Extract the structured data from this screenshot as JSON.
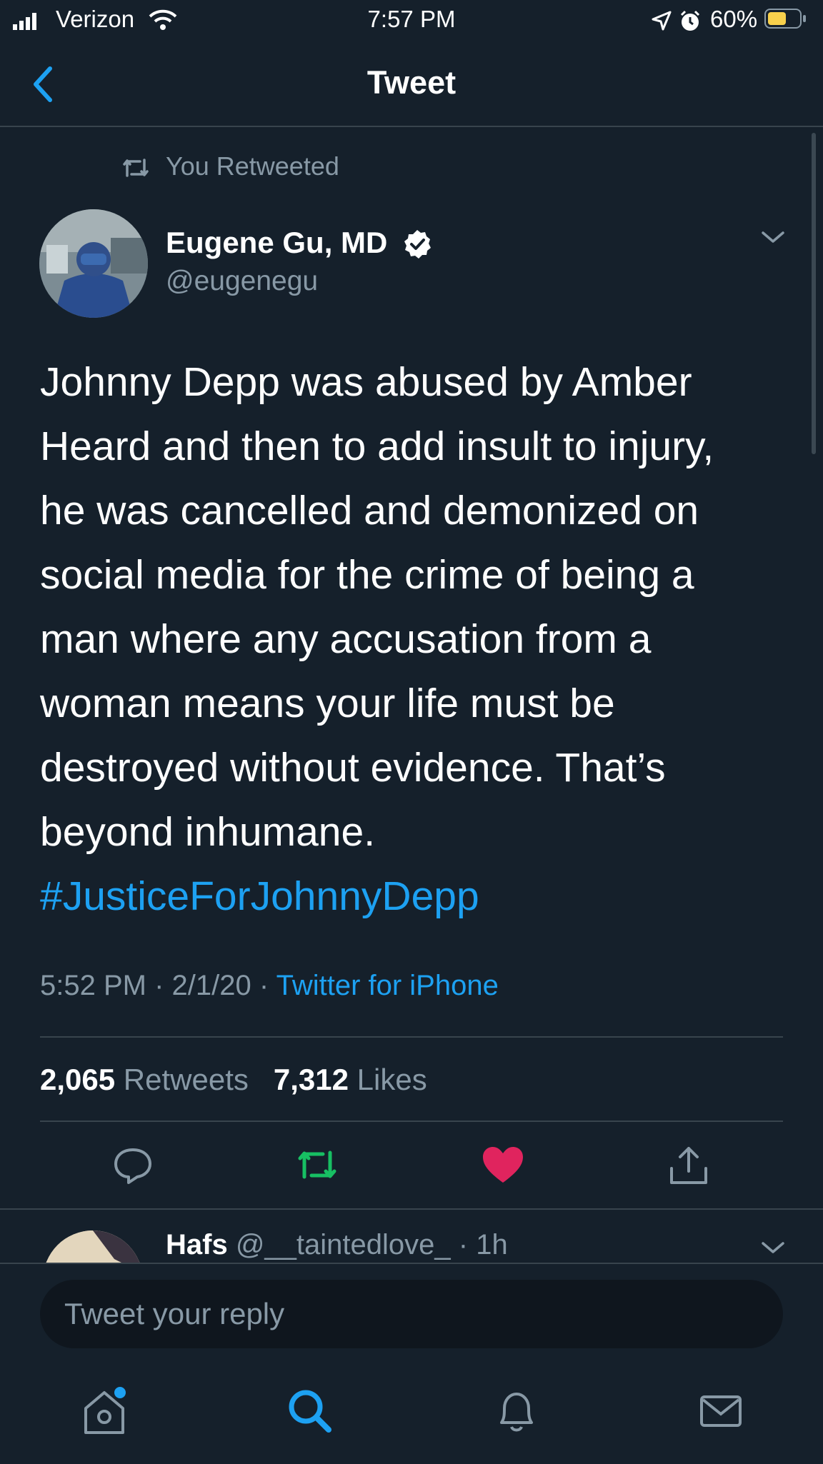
{
  "status_bar": {
    "carrier": "Verizon",
    "time": "7:57 PM",
    "battery_percent": "60%",
    "battery_level": 0.6,
    "battery_color": "#f7d04c"
  },
  "nav": {
    "title": "Tweet",
    "back_icon": "chevron-left-icon"
  },
  "tweet": {
    "retweet_context": "You Retweeted",
    "author": {
      "name": "Eugene Gu, MD",
      "handle": "@eugenegu",
      "verified": true
    },
    "lines": [
      "Johnny Depp was abused by Amber",
      "Heard and then to add insult to injury,",
      "he was cancelled and demonized on",
      "social media for the crime of being a",
      "man where any accusation from a",
      "woman means your life must be",
      "destroyed without evidence. That’s",
      "beyond inhumane."
    ],
    "hashtag": "#JusticeForJohnnyDepp",
    "time": "5:52 PM",
    "date": "2/1/20",
    "source": "Twitter for iPhone",
    "retweets_count": "2,065",
    "retweets_label": "Retweets",
    "likes_count": "7,312",
    "likes_label": "Likes",
    "retweeted": true,
    "liked": true
  },
  "reply_preview": {
    "name": "Hafs",
    "handle_time": "@__taintedlove_ · 1h"
  },
  "compose": {
    "placeholder": "Tweet your reply"
  },
  "tab_bar": [
    "home-icon",
    "search-icon",
    "notifications-icon",
    "messages-icon"
  ],
  "colors": {
    "background": "#15202b",
    "accent": "#1da1f2",
    "retweet_green": "#17bf63",
    "like_red": "#e0245e",
    "secondary_text": "#8899a6"
  }
}
